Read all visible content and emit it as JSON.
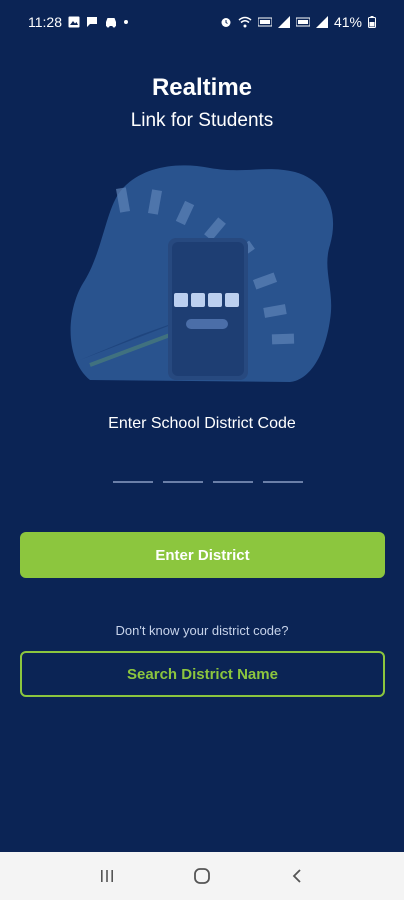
{
  "status_bar": {
    "time": "11:28",
    "battery": "41%",
    "left_icons": [
      "image-icon",
      "chat-icon",
      "car-icon"
    ],
    "right_icons": [
      "alarm-icon",
      "wifi-icon",
      "volte-icon",
      "signal-icon",
      "battery-icon"
    ]
  },
  "header": {
    "title": "Realtime",
    "subtitle": "Link for Students"
  },
  "illustration": {
    "icon": "phone-code-icon"
  },
  "form": {
    "prompt": "Enter School District Code",
    "code_length": 4,
    "primary_button": "Enter District",
    "helper_text": "Don't know your district code?",
    "secondary_button": "Search District Name"
  },
  "nav_bar": {
    "icons": [
      "recent-apps-icon",
      "home-icon",
      "back-icon"
    ]
  },
  "colors": {
    "background": "#0b2455",
    "accent": "#8cc63e",
    "illustration": "#2f5c99"
  }
}
